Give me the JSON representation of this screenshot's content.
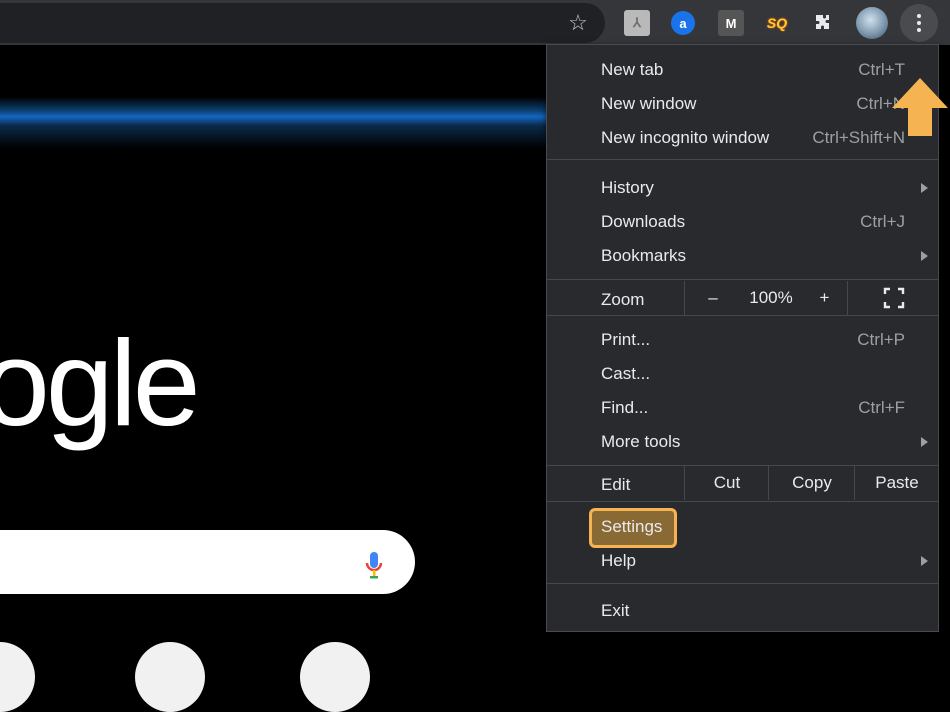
{
  "toolbar": {
    "star_icon": "star-icon",
    "extensions": [
      {
        "name": "pdf-extension-icon",
        "glyph": "⅄"
      },
      {
        "name": "amazon-extension-icon",
        "glyph": "a"
      },
      {
        "name": "m-extension-icon",
        "glyph": "M"
      },
      {
        "name": "sq-extension-icon",
        "glyph": "SQ"
      },
      {
        "name": "puzzle-extensions-icon",
        "glyph": "✚"
      }
    ]
  },
  "page": {
    "logo_text": "ogle"
  },
  "menu": {
    "new_tab": {
      "label": "New tab",
      "shortcut": "Ctrl+T"
    },
    "new_window": {
      "label": "New window",
      "shortcut": "Ctrl+N"
    },
    "new_incognito": {
      "label": "New incognito window",
      "shortcut": "Ctrl+Shift+N"
    },
    "history": {
      "label": "History"
    },
    "downloads": {
      "label": "Downloads",
      "shortcut": "Ctrl+J"
    },
    "bookmarks": {
      "label": "Bookmarks"
    },
    "zoom": {
      "label": "Zoom",
      "minus": "–",
      "value": "100%",
      "plus": "+"
    },
    "print": {
      "label": "Print...",
      "shortcut": "Ctrl+P"
    },
    "cast": {
      "label": "Cast..."
    },
    "find": {
      "label": "Find...",
      "shortcut": "Ctrl+F"
    },
    "more_tools": {
      "label": "More tools"
    },
    "edit": {
      "label": "Edit",
      "cut": "Cut",
      "copy": "Copy",
      "paste": "Paste"
    },
    "settings": {
      "label": "Settings"
    },
    "help": {
      "label": "Help"
    },
    "exit": {
      "label": "Exit"
    }
  },
  "colors": {
    "highlight_border": "#f5b451",
    "highlight_fill": "#8a6a34",
    "menu_bg": "#292a2d",
    "toolbar_bg": "#35363a"
  }
}
